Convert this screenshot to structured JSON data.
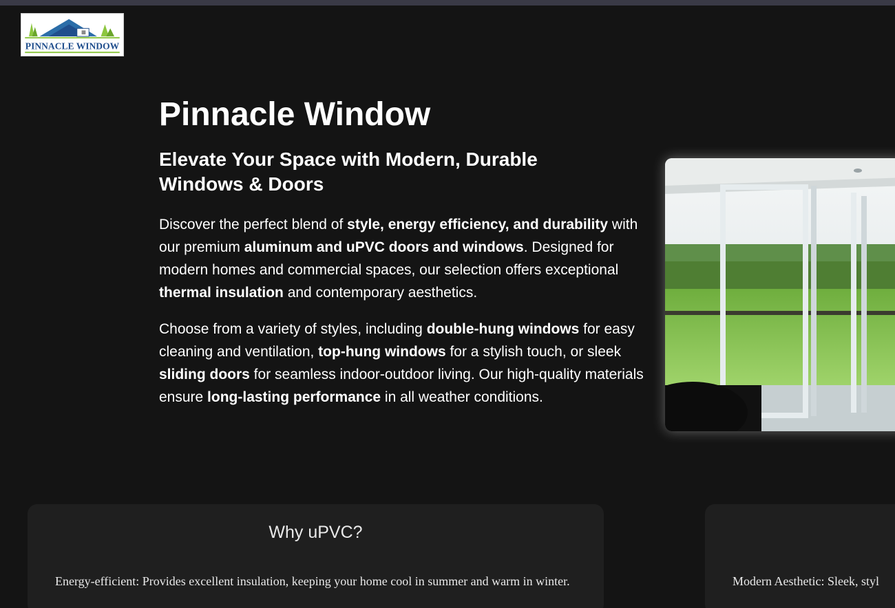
{
  "logo": {
    "text": "PINNACLE WINDOW"
  },
  "hero": {
    "title": "Pinnacle Window",
    "subtitle": "Elevate Your Space with Modern, Durable Windows & Doors",
    "p1": {
      "t1": "Discover the perfect blend of ",
      "b1": "style, energy efficiency, and durability",
      "t2": " with our premium ",
      "b2": "aluminum and uPVC doors and windows",
      "t3": ". Designed for modern homes and commercial spaces, our selection offers exceptional ",
      "b3": "thermal insulation",
      "t4": " and contemporary aesthetics."
    },
    "p2": {
      "t1": "Choose from a variety of styles, including ",
      "b1": "double-hung windows",
      "t2": " for easy cleaning and ventilation, ",
      "b2": "top-hung windows",
      "t3": " for a stylish touch, or sleek ",
      "b3": "sliding doors",
      "t4": " for seamless indoor-outdoor living. Our high-quality materials ensure ",
      "b4": "long-lasting performance",
      "t5": " in all weather conditions."
    }
  },
  "cards": [
    {
      "title": "Why uPVC?",
      "text": "Energy-efficient: Provides excellent insulation, keeping your home cool in summer and warm in winter."
    },
    {
      "title": "",
      "text": "Modern Aesthetic: Sleek, styl"
    }
  ],
  "colors": {
    "background": "#141414",
    "card": "#1f1f1f",
    "logo_blue": "#1f4e8c",
    "logo_green": "#8cc63f"
  }
}
